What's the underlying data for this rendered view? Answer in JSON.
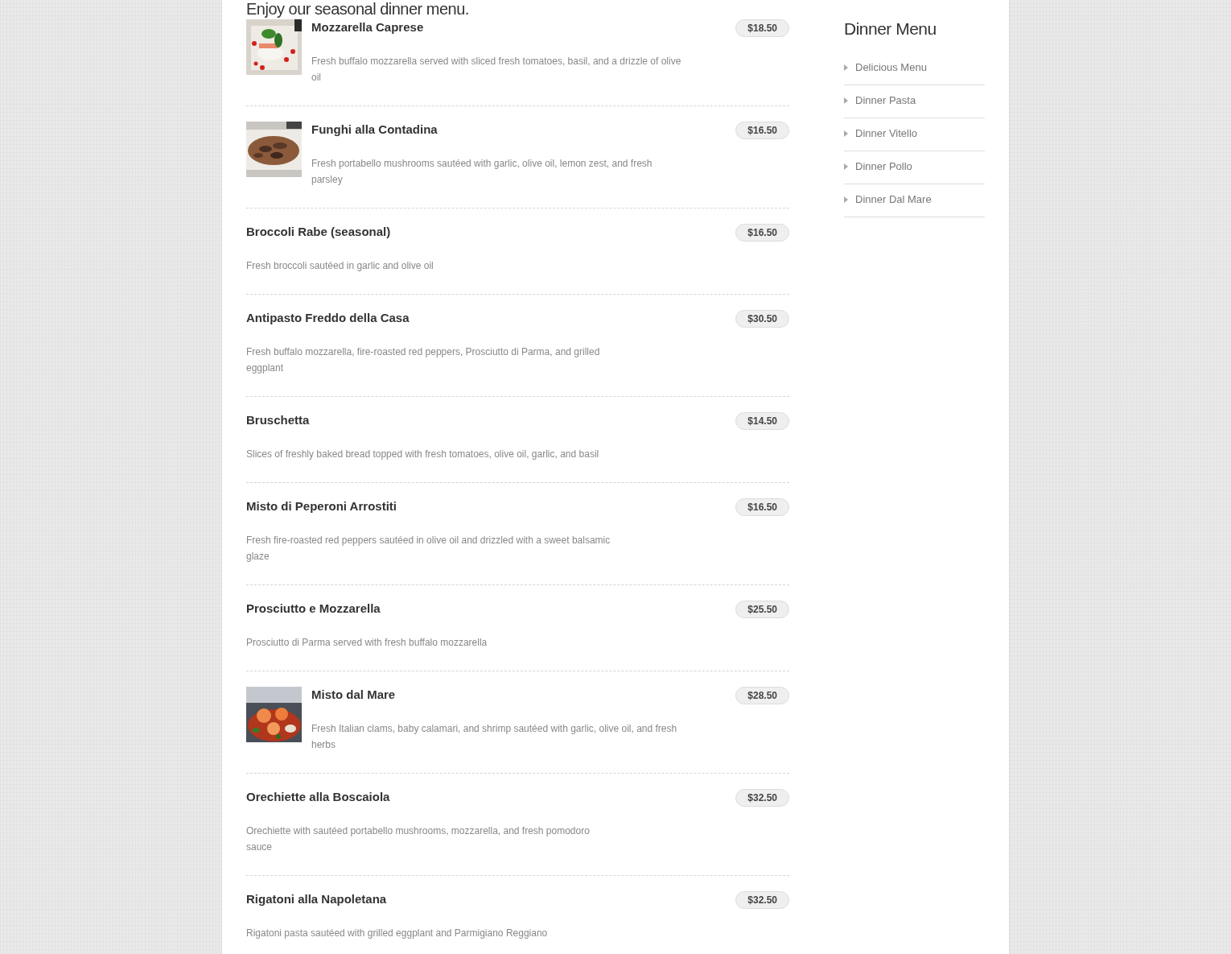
{
  "heading": "Enjoy our seasonal dinner menu.",
  "menu_items": [
    {
      "name": "Mozzarella Caprese",
      "price": "$18.50",
      "description": "Fresh buffalo mozzarella served with sliced fresh tomatoes, basil, and a drizzle of olive oil"
    },
    {
      "name": "Funghi alla Contadina",
      "price": "$16.50",
      "description": "Fresh portabello mushrooms sautéed with garlic, olive oil, lemon zest, and fresh parsley"
    },
    {
      "name": "Broccoli Rabe (seasonal)",
      "price": "$16.50",
      "description": "Fresh broccoli sautéed in garlic and olive oil"
    },
    {
      "name": "Antipasto Freddo della Casa",
      "price": "$30.50",
      "description": "Fresh buffalo mozzarella, fire-roasted red peppers, Prosciutto di Parma, and grilled eggplant"
    },
    {
      "name": "Bruschetta",
      "price": "$14.50",
      "description": "Slices of freshly baked bread topped with fresh tomatoes, olive oil, garlic, and basil"
    },
    {
      "name": "Misto di Peperoni Arrostiti",
      "price": "$16.50",
      "description": "Fresh fire-roasted red peppers sautéed in olive oil and drizzled with a sweet balsamic glaze"
    },
    {
      "name": "Prosciutto e Mozzarella",
      "price": "$25.50",
      "description": "Prosciutto di Parma served with fresh buffalo mozzarella"
    },
    {
      "name": "Misto dal Mare",
      "price": "$28.50",
      "description": "Fresh Italian clams, baby calamari, and shrimp sautéed with garlic, olive oil, and fresh herbs"
    },
    {
      "name": "Orechiette alla Boscaiola",
      "price": "$32.50",
      "description": "Orechiette with sautéed portabello mushrooms, mozzarella, and fresh pomodoro sauce"
    },
    {
      "name": "Rigatoni alla Napoletana",
      "price": "$32.50",
      "description": "Rigatoni pasta sautéed with grilled eggplant and Parmigiano Reggiano"
    }
  ],
  "sidebar": {
    "title": "Dinner Menu",
    "items": [
      "Delicious Menu",
      "Dinner Pasta",
      "Dinner Vitello",
      "Dinner Pollo",
      "Dinner Dal Mare"
    ]
  }
}
